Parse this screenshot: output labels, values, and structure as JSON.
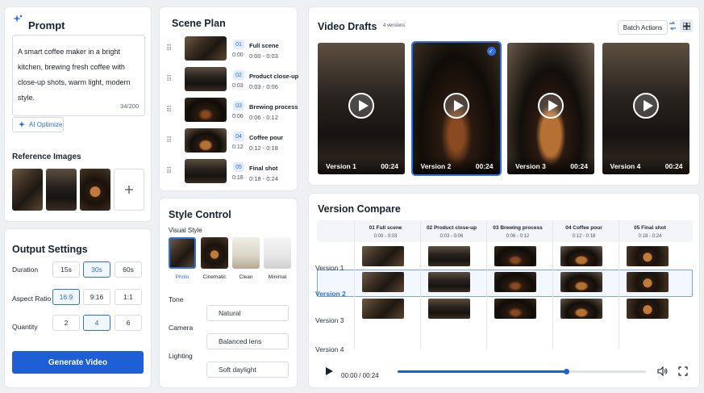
{
  "prompt": {
    "title": "Prompt",
    "text": "A smart coffee maker in a bright kitchen, brewing fresh coffee with close-up shots, warm light, modern style.",
    "counter": "34/200",
    "optimize_label": "AI Optimize",
    "reference_title": "Reference Images",
    "add_icon": "plus-icon"
  },
  "output": {
    "title": "Output Settings",
    "duration_label": "Duration",
    "duration_options": [
      "15s",
      "30s",
      "60s"
    ],
    "duration_selected": "30s",
    "aspect_label": "Aspect Ratio",
    "aspect_options": [
      "16:9",
      "9:16",
      "1:1"
    ],
    "aspect_selected": "16:9",
    "quantity_label": "Quantity",
    "quantity_options": [
      "2",
      "4",
      "6"
    ],
    "quantity_selected": "4",
    "generate_label": "Generate Video"
  },
  "scene": {
    "title": "Scene Plan",
    "items": [
      {
        "num": "01",
        "name": "Full scene",
        "start": "0:00",
        "range": "0:00 - 0:03"
      },
      {
        "num": "02",
        "name": "Product close-up",
        "start": "0:03",
        "range": "0:03 - 0:06"
      },
      {
        "num": "03",
        "name": "Brewing process",
        "start": "0:06",
        "range": "0:06 - 0:12"
      },
      {
        "num": "04",
        "name": "Coffee pour",
        "start": "0:12",
        "range": "0:12 - 0:18"
      },
      {
        "num": "05",
        "name": "Final shot",
        "start": "0:18",
        "range": "0:18 - 0:24"
      }
    ]
  },
  "style": {
    "title": "Style Control",
    "visual_label": "Visual Style",
    "styles": [
      "Photo",
      "Cinematic",
      "Clean",
      "Minimal"
    ],
    "style_selected": "Photo",
    "tone_label": "Tone",
    "tone_value": "Natural",
    "camera_label": "Camera",
    "camera_value": "Balanced lens",
    "lighting_label": "Lighting",
    "lighting_value": "Soft daylight"
  },
  "drafts": {
    "title": "Video Drafts",
    "count_badge": "4 versions",
    "batch_label": "Batch Actions",
    "videos": [
      {
        "name": "Version 1",
        "duration": "00:24"
      },
      {
        "name": "Version 2",
        "duration": "00:24"
      },
      {
        "name": "Version 3",
        "duration": "00:24"
      },
      {
        "name": "Version 4",
        "duration": "00:24"
      }
    ],
    "selected_video": "Version 2"
  },
  "compare": {
    "title": "Version Compare",
    "columns": [
      {
        "title": "01 Full scene",
        "range": "0:00 - 0:03"
      },
      {
        "title": "02 Product close-up",
        "range": "0:03 - 0:06"
      },
      {
        "title": "03 Brewing process",
        "range": "0:06 - 0:12"
      },
      {
        "title": "04 Coffee pour",
        "range": "0:12 - 0:18"
      },
      {
        "title": "05 Final shot",
        "range": "0:18 - 0:24"
      }
    ],
    "rows": [
      "Version 1",
      "Version 2",
      "Version 3",
      "Version 4"
    ],
    "selected_row": "Version 2",
    "time": "00:00 / 00:24",
    "progress": 0.68
  },
  "colors": {
    "accent": "#2f6fe0",
    "button": "#1f5fd6"
  }
}
